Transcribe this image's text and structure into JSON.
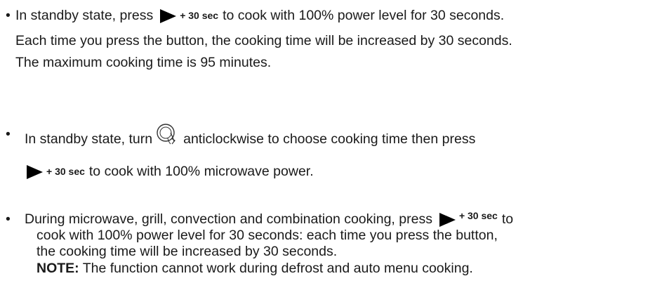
{
  "bullets": [
    {
      "marker": "•",
      "line1_before": "In standby state, press",
      "line1_after": "to cook with 100% power level for 30 seconds.",
      "line2": "Each time you press the button, the cooking time will be increased by 30 seconds.",
      "line3": "The maximum cooking time is 95 minutes."
    },
    {
      "marker": "•",
      "line1_before": "In standby state, turn",
      "line1_after": "anticlockwise to choose cooking time then press",
      "line2_after": "to cook with 100% microwave power."
    },
    {
      "marker": "•",
      "line1_before": "During microwave, grill, convection and combination cooking, press",
      "line1_after": "to",
      "line2": "cook with 100% power level for 30 seconds: each time you press the button,",
      "line3": "the cooking time will be increased by 30 seconds.",
      "note_label": "NOTE:",
      "note_text": " The function cannot work during defrost and auto menu cooking."
    }
  ],
  "button_label": "+ 30 sec",
  "icons": {
    "button": "play-triangle-icon",
    "knob": "dial-knob-icon"
  }
}
